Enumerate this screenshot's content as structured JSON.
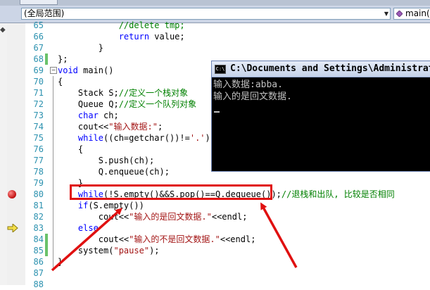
{
  "nav": {
    "scope_label": "(全局范围)",
    "member_label": "main()"
  },
  "console": {
    "title": "C:\\Documents and Settings\\Administrator\\",
    "icon_text": "C:\\",
    "lines": [
      "输入数据:abba.",
      "输入的是回文数据."
    ]
  },
  "code_lines": [
    {
      "n": "65",
      "t": "            //delete tmp;"
    },
    {
      "n": "66",
      "t": "            return value;"
    },
    {
      "n": "67",
      "t": "        }"
    },
    {
      "n": "68",
      "t": "};"
    },
    {
      "n": "69",
      "t": "void main()"
    },
    {
      "n": "70",
      "t": "{"
    },
    {
      "n": "71",
      "t": "    Stack S;//定义一个栈对象"
    },
    {
      "n": "72",
      "t": "    Queue Q;//定义一个队列对象"
    },
    {
      "n": "73",
      "t": "    char ch;"
    },
    {
      "n": "74",
      "t": "    cout<<\"输入数据:\";"
    },
    {
      "n": "75",
      "t": "    while((ch=getchar())!='.')"
    },
    {
      "n": "76",
      "t": "    {"
    },
    {
      "n": "77",
      "t": "        S.push(ch);"
    },
    {
      "n": "78",
      "t": "        Q.enqueue(ch);"
    },
    {
      "n": "79",
      "t": "    }"
    },
    {
      "n": "80",
      "t": "    while(!S.empty()&&S.pop()==Q.dequeue());//退栈和出队, 比较是否相同"
    },
    {
      "n": "81",
      "t": "    if(S.empty())"
    },
    {
      "n": "82",
      "t": "        cout<<\"输入的是回文数据.\"<<endl;"
    },
    {
      "n": "83",
      "t": "    else"
    },
    {
      "n": "84",
      "t": "        cout<<\"输入的不是回文数据.\"<<endl;"
    },
    {
      "n": "85",
      "t": "    system(\"pause\");"
    },
    {
      "n": "86",
      "t": "}"
    },
    {
      "n": "87",
      "t": ""
    },
    {
      "n": "88",
      "t": ""
    }
  ],
  "colors": {
    "keyword": "#0000ff",
    "comment": "#008000",
    "string": "#a31515",
    "line_number": "#2b91af",
    "annotation": "#e01010"
  }
}
